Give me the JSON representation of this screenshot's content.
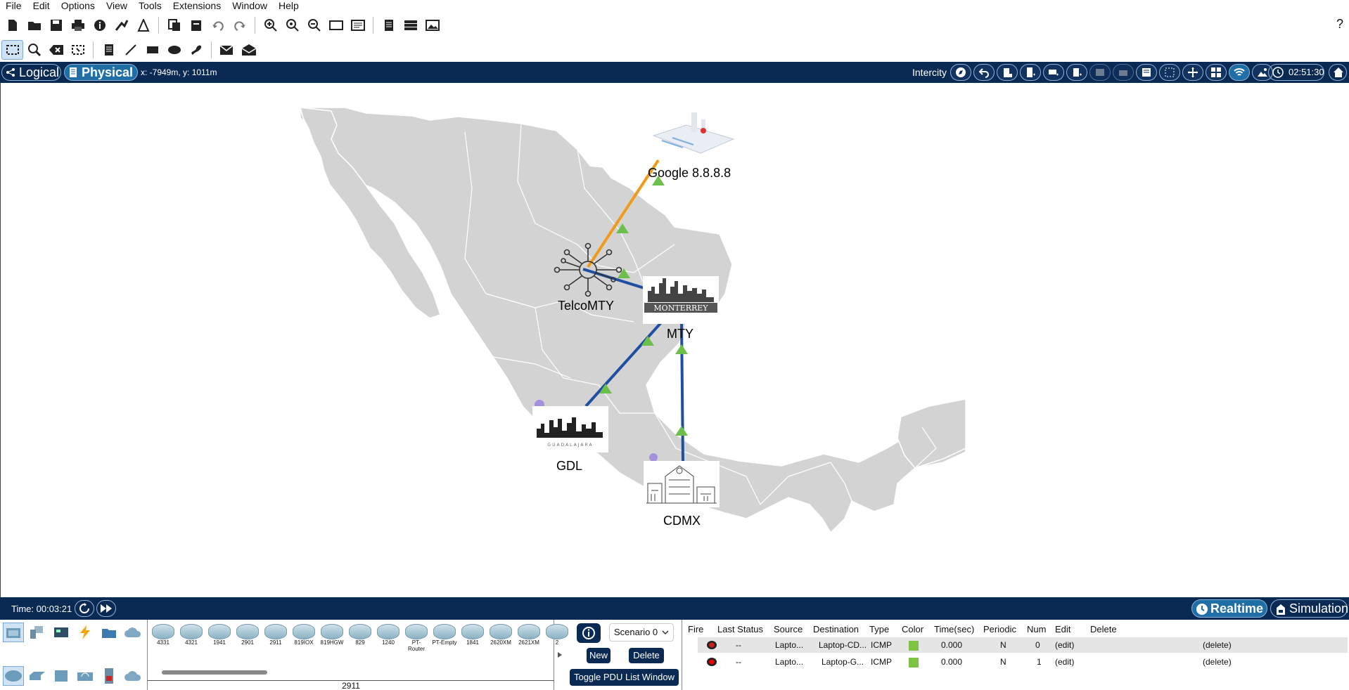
{
  "menu": [
    "File",
    "Edit",
    "Options",
    "View",
    "Tools",
    "Extensions",
    "Window",
    "Help"
  ],
  "toolbar_main": [
    "new-icon",
    "open-icon",
    "save-icon",
    "print-icon",
    "info-icon",
    "activity-wizard-icon",
    "custom-device-icon",
    "copy-icon",
    "paste-icon",
    "undo-icon",
    "redo-icon",
    "zoom-in-icon",
    "zoom-reset-icon",
    "zoom-out-icon",
    "drawing-palette-icon",
    "custom-devices-dialog-icon",
    "notes-icon",
    "device-template-icon",
    "image-icon"
  ],
  "toolbar_tools": [
    "select-icon",
    "inspect-icon",
    "delete-icon",
    "resize-icon",
    "place-note-icon",
    "line-icon",
    "rectangle-icon",
    "ellipse-icon",
    "freeform-icon",
    "add-simple-pdu-icon",
    "add-complex-pdu-icon"
  ],
  "help_label": "?",
  "nav": {
    "logical_label": "Logical",
    "physical_label": "Physical",
    "coordinates": "x: -7949m, y: 1011m",
    "location": "Intercity",
    "clock": "02:51:30",
    "icons": [
      "navigation-icon",
      "back-icon",
      "new-building-icon",
      "new-rack-icon",
      "new-multiuser-icon",
      "new-container-icon",
      "new-disabled1-icon",
      "new-disabled2-icon",
      "set-background-icon",
      "grid-icon",
      "move-icon",
      "view-icon",
      "wireless-icon",
      "background-image-icon"
    ]
  },
  "devices": [
    {
      "name": "Google 8.8.8.8"
    },
    {
      "name": "TelcoMTY"
    },
    {
      "name": "MTY"
    },
    {
      "name": "GDL"
    },
    {
      "name": "CDMX"
    }
  ],
  "building_logo_texts": {
    "mty": "MONTERREY",
    "gdl": "GUADALAJARA"
  },
  "colors": {
    "link_copper": "#1f4fa3",
    "link_fiber": "#f09a1a",
    "link_status": "#4caf3a",
    "nav_bg": "#0b2a53",
    "map_land": "#d3d3d3"
  },
  "timebar": {
    "time": "Time: 00:03:21",
    "realtime_label": "Realtime",
    "simulation_label": "Simulation"
  },
  "categories": [
    "network-devices",
    "end-devices",
    "components",
    "connections",
    "miscellaneous",
    "multiuser"
  ],
  "subcategories": [
    "routers",
    "switches",
    "hubs",
    "wireless-devices",
    "security",
    "wan-emulation"
  ],
  "models": [
    "4331",
    "4321",
    "1941",
    "2901",
    "2911",
    "819IOX",
    "819HGW",
    "829",
    "1240",
    "PT-Router",
    "PT-Empty",
    "1841",
    "2620XM",
    "2621XM",
    "2"
  ],
  "selected_model": "2911",
  "scenario": {
    "selected": "Scenario 0",
    "new_label": "New",
    "delete_label": "Delete",
    "toggle_label": "Toggle PDU List Window"
  },
  "pdu_headers": [
    "Fire",
    "Last Status",
    "Source",
    "Destination",
    "Type",
    "Color",
    "Time(sec)",
    "Periodic",
    "Num",
    "Edit",
    "Delete"
  ],
  "pdu_rows": [
    {
      "last_status": "--",
      "source": "Lapto...",
      "destination": "Laptop-CD...",
      "type": "ICMP",
      "color": "#7dc242",
      "time": "0.000",
      "periodic": "N",
      "num": "0",
      "edit": "(edit)",
      "delete": "(delete)"
    },
    {
      "last_status": "--",
      "source": "Lapto...",
      "destination": "Laptop-G...",
      "type": "ICMP",
      "color": "#7dc242",
      "time": "0.000",
      "periodic": "N",
      "num": "1",
      "edit": "(edit)",
      "delete": "(delete)"
    }
  ]
}
